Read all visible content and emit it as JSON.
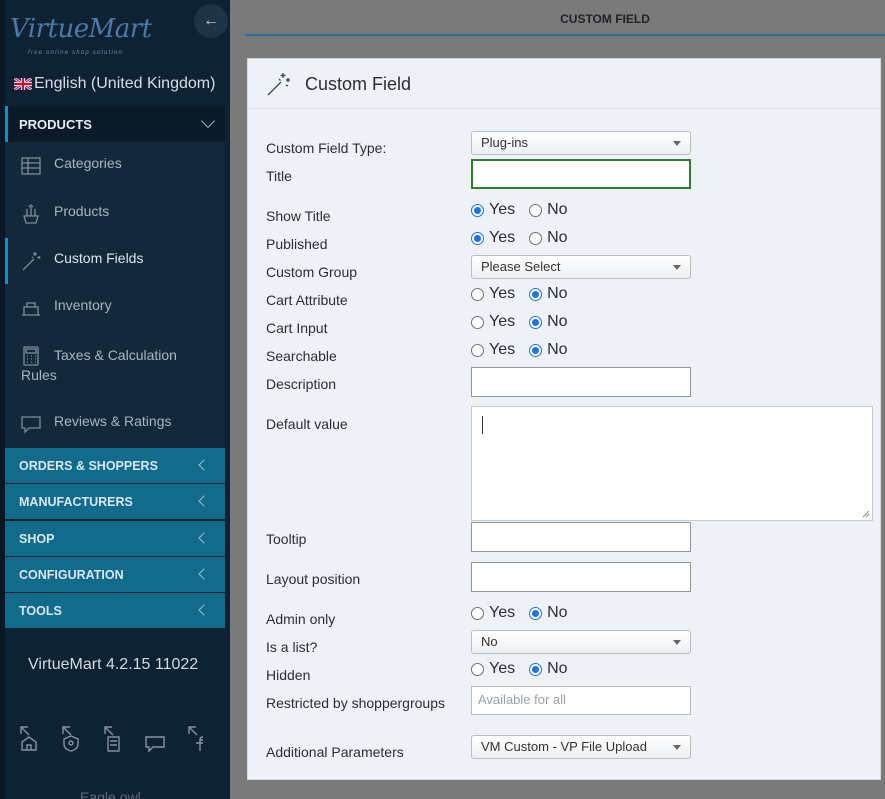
{
  "sidebar": {
    "logo_text": "VirtueMart",
    "logo_subtitle": "free online shop solution",
    "language": "English (United Kingdom)",
    "products_section": "PRODUCTS",
    "items": [
      {
        "label": "Categories",
        "icon": "categories-icon"
      },
      {
        "label": "Products",
        "icon": "products-icon"
      },
      {
        "label": "Custom Fields",
        "icon": "wand-icon",
        "active": true
      },
      {
        "label": "Inventory",
        "icon": "inventory-icon"
      },
      {
        "label": "Taxes & Calculation",
        "label_line2": "Rules",
        "icon": "calculator-icon"
      },
      {
        "label": "Reviews & Ratings",
        "icon": "comment-icon"
      }
    ],
    "sections": [
      "ORDERS & SHOPPERS",
      "MANUFACTURERS",
      "SHOP",
      "CONFIGURATION",
      "TOOLS"
    ],
    "version": "VirtueMart 4.2.15 11022",
    "footer_text": "Eagle owl"
  },
  "header": {
    "title": "CUSTOM FIELD"
  },
  "panel": {
    "title": "Custom Field"
  },
  "form": {
    "custom_field_type": {
      "label": "Custom Field Type:",
      "value": "Plug-ins"
    },
    "title": {
      "label": "Title",
      "value": ""
    },
    "show_title": {
      "label": "Show Title",
      "value": "Yes"
    },
    "published": {
      "label": "Published",
      "value": "Yes"
    },
    "custom_group": {
      "label": "Custom Group",
      "value": "Please Select"
    },
    "cart_attribute": {
      "label": "Cart Attribute",
      "value": "No"
    },
    "cart_input": {
      "label": "Cart Input",
      "value": "No"
    },
    "searchable": {
      "label": "Searchable",
      "value": "No"
    },
    "description": {
      "label": "Description",
      "value": ""
    },
    "default_value": {
      "label": "Default value",
      "value": ""
    },
    "tooltip": {
      "label": "Tooltip",
      "value": ""
    },
    "layout_position": {
      "label": "Layout position",
      "value": ""
    },
    "admin_only": {
      "label": "Admin only",
      "value": "No"
    },
    "is_a_list": {
      "label": "Is a list?",
      "value": "No"
    },
    "hidden": {
      "label": "Hidden",
      "value": "No"
    },
    "restricted": {
      "label": "Restricted by shoppergroups",
      "placeholder": "Available for all"
    },
    "additional_parameters": {
      "label": "Additional Parameters",
      "value": "VM Custom - VP File Upload"
    },
    "yes_label": "Yes",
    "no_label": "No"
  },
  "colors": {
    "sidebar_bg": "#0f2234",
    "section_bg": "#136b8c",
    "accent": "#1a8ec3",
    "radio_checked": "#1a73e8",
    "focus_border": "#2f7d32"
  }
}
